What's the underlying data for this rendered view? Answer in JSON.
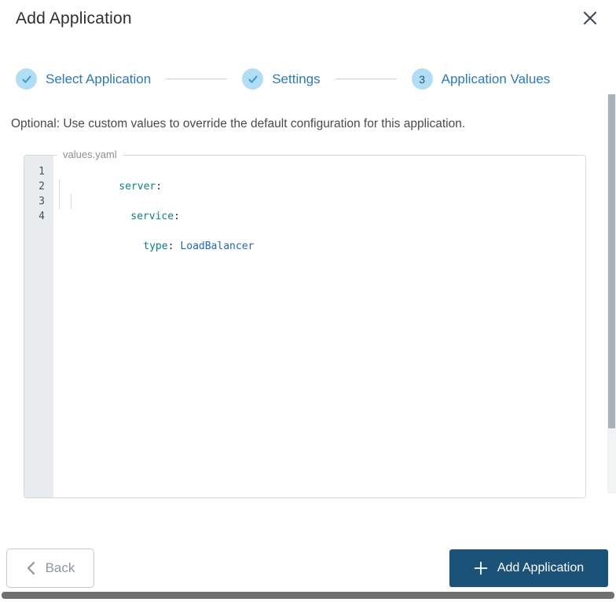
{
  "colors": {
    "accent_blue": "#2b7ab5",
    "step_circle_bg": "#b1ddf5",
    "step_check": "#3e96d2",
    "primary_button_bg": "#1a5278",
    "code_key_teal": "#0e7d88",
    "code_value_blue": "#2268b2",
    "gutter_bg": "#e9edf0",
    "line_number_color": "#46535e"
  },
  "header": {
    "title": "Add Application"
  },
  "stepper": {
    "steps": [
      {
        "label": "Select Application",
        "status": "completed"
      },
      {
        "label": "Settings",
        "status": "completed"
      },
      {
        "number": "3",
        "label": "Application Values",
        "status": "current"
      }
    ]
  },
  "description": "Optional: Use custom values to override the default configuration for this application.",
  "editor": {
    "filename": "values.yaml",
    "language": "yaml",
    "content": "server:\n  service:\n    type: LoadBalancer\n",
    "lines": [
      {
        "num": "1",
        "key": "server",
        "colon": ":",
        "value": ""
      },
      {
        "num": "2",
        "key": "service",
        "colon": ":",
        "value": ""
      },
      {
        "num": "3",
        "key": "type",
        "colon": ":",
        "value": "LoadBalancer"
      },
      {
        "num": "4",
        "key": "",
        "colon": "",
        "value": ""
      }
    ]
  },
  "footer": {
    "back_label": "Back",
    "submit_label": "Add Application"
  }
}
